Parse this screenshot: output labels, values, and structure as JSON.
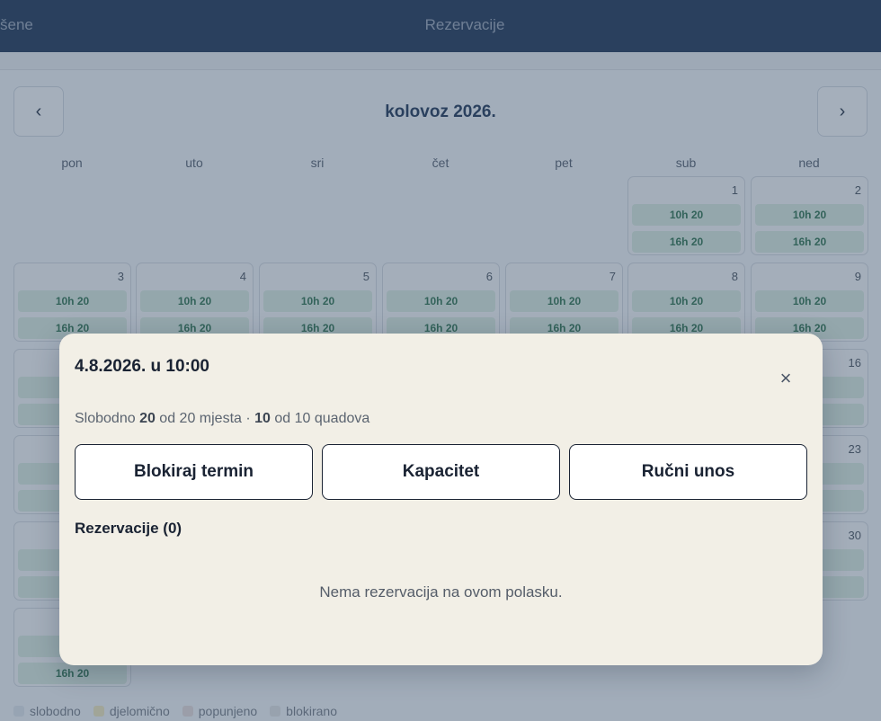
{
  "header": {
    "back_label": "šene",
    "title": "Rezervacije"
  },
  "calendar": {
    "month": "kolovoz 2026.",
    "prev_icon": "‹",
    "next_icon": "›",
    "weekdays": [
      "pon",
      "uto",
      "sri",
      "čet",
      "pet",
      "sub",
      "ned"
    ],
    "slot_a": "10h 20",
    "slot_b": "16h 20",
    "days": [
      "1",
      "2",
      "3",
      "4",
      "5",
      "6",
      "7",
      "8",
      "9",
      "16",
      "23",
      "30"
    ]
  },
  "legend": [
    "slobodno",
    "djelomično",
    "popunjeno",
    "blokirano"
  ],
  "legend_colors": [
    "#cdd7e0",
    "#ddd9b5",
    "#d3cdd0",
    "#cfd3d9"
  ],
  "modal": {
    "title": "4.8.2026. u 10:00",
    "close_icon": "×",
    "summary_prefix": "Slobodno ",
    "free_seats": "20",
    "seats_suffix": " od 20 mjesta · ",
    "free_quads": "10",
    "quads_suffix": " od 10 quadova",
    "btn_block": "Blokiraj termin",
    "btn_capacity": "Kapacitet",
    "btn_manual": "Ručni unos",
    "reservations_title": "Rezervacije (0)",
    "empty_text": "Nema rezervacija na ovom polasku."
  },
  "colors": {
    "header_bg": "#1d3657",
    "slot_text": "#2d6e52",
    "modal_bg": "#f2efe6"
  }
}
